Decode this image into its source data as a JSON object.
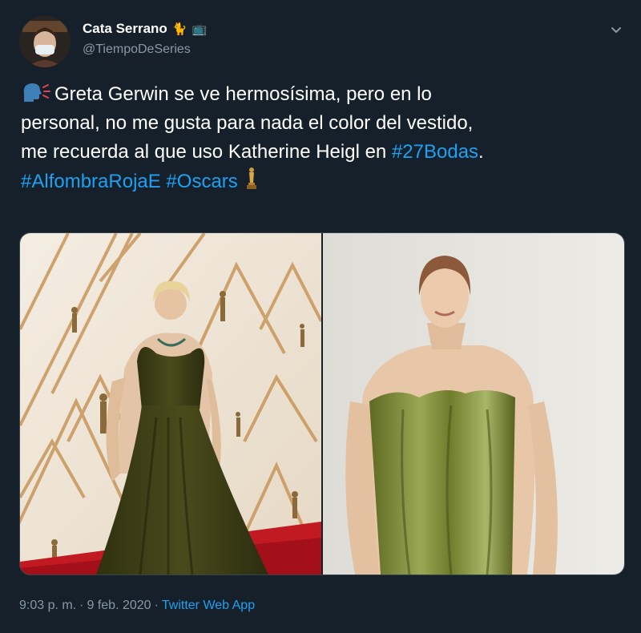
{
  "user": {
    "display_name": "Cata Serrano",
    "handle": "@TiempoDeSeries",
    "badge_emojis": [
      "🐈",
      "📺"
    ]
  },
  "tweet": {
    "line1_text": "Greta Gerwin se ve hermosísima, pero en lo",
    "line2_text": "personal, no me gusta para nada el color del vestido,",
    "line3_text": "me recuerda al que uso Katherine Heigl en ",
    "hashtag_27bodas": "#27Bodas",
    "line3_end": ".",
    "hashtag_alfombra": "#AlfombraRojaE",
    "hashtag_oscars": "#Oscars"
  },
  "icons": {
    "leading": "speaking-head-icon",
    "trailing": "oscar-trophy-icon",
    "menu": "chevron-down-icon"
  },
  "footer": {
    "time": "9:03 p. m.",
    "sep1": "·",
    "date": "9 feb. 2020",
    "sep2": "·",
    "app": "Twitter Web App"
  },
  "colors": {
    "background": "#15202b",
    "link": "#1da1f2",
    "secondary_text": "#8899a6",
    "dress_left": "#3d3f17",
    "dress_right": "#7d8a3a",
    "carpet": "#c41522"
  }
}
